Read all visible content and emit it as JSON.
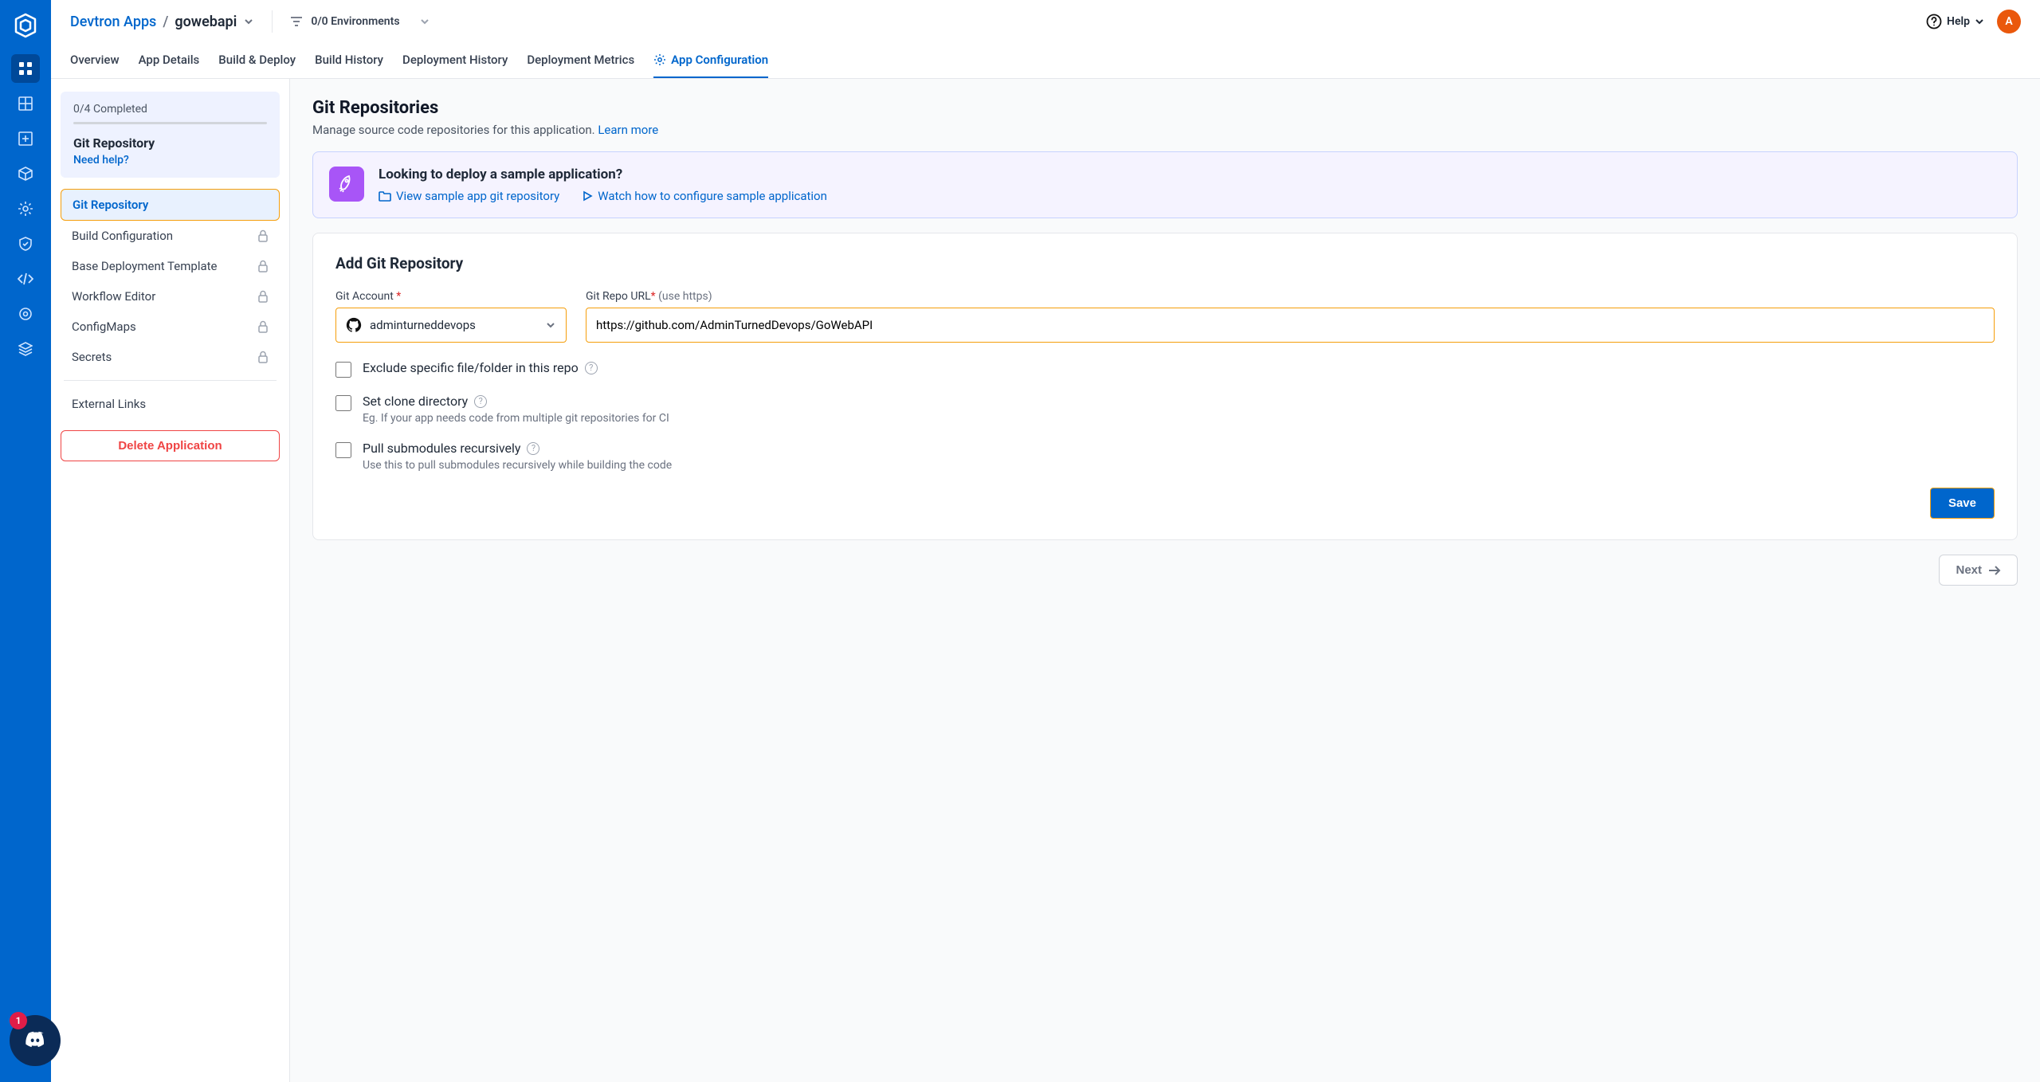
{
  "breadcrumb": {
    "root": "Devtron Apps",
    "current": "gowebapi"
  },
  "env_filter": "0/0 Environments",
  "help_label": "Help",
  "avatar_initial": "A",
  "tabs": [
    {
      "label": "Overview"
    },
    {
      "label": "App Details"
    },
    {
      "label": "Build & Deploy"
    },
    {
      "label": "Build History"
    },
    {
      "label": "Deployment History"
    },
    {
      "label": "Deployment Metrics"
    },
    {
      "label": "App Configuration"
    }
  ],
  "sidebar": {
    "progress": {
      "completed": "0/4 Completed",
      "step_title": "Git Repository",
      "help_link": "Need help?"
    },
    "items": [
      {
        "label": "Git Repository",
        "active": true,
        "locked": false
      },
      {
        "label": "Build Configuration",
        "locked": true
      },
      {
        "label": "Base Deployment Template",
        "locked": true
      },
      {
        "label": "Workflow Editor",
        "locked": true
      },
      {
        "label": "ConfigMaps",
        "locked": true
      },
      {
        "label": "Secrets",
        "locked": true
      }
    ],
    "external_links": "External Links",
    "delete_label": "Delete Application"
  },
  "page": {
    "title": "Git Repositories",
    "subtitle": "Manage source code repositories for this application. ",
    "learn_more": "Learn more",
    "banner": {
      "title": "Looking to deploy a sample application?",
      "link1": "View sample app git repository",
      "link2": "Watch how to configure sample application"
    },
    "form": {
      "heading": "Add Git Repository",
      "account_label": "Git Account",
      "account_value": "adminturneddevops",
      "url_label": "Git Repo URL",
      "url_hint": "(use https)",
      "url_value": "https://github.com/AdminTurnedDevops/GoWebAPI",
      "check1": {
        "label": "Exclude specific file/folder in this repo"
      },
      "check2": {
        "label": "Set clone directory",
        "desc": "Eg. If your app needs code from multiple git repositories for CI"
      },
      "check3": {
        "label": "Pull submodules recursively",
        "desc": "Use this to pull submodules recursively while building the code"
      },
      "save": "Save"
    },
    "next": "Next"
  },
  "discord_count": "1"
}
